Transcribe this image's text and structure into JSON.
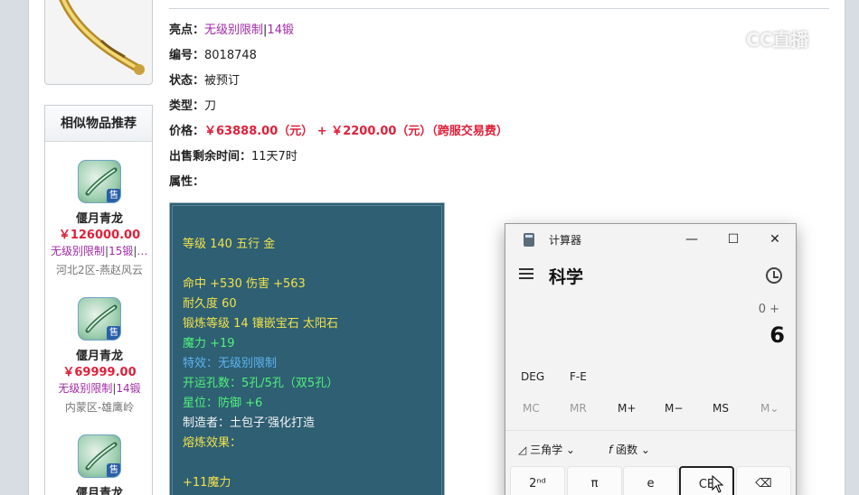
{
  "similar": {
    "title": "相似物品推荐",
    "sold_badge": "售",
    "items": [
      {
        "name": "偃月青龙",
        "price": "￥126000.00",
        "tag1": "无级别限制",
        "tag2": "15锻",
        "tag3": "力…",
        "server": "河北2区-燕赵风云"
      },
      {
        "name": "偃月青龙",
        "price": "￥69999.00",
        "tag1": "无级别限制",
        "tag2": "14锻",
        "tag3": "",
        "server": "内蒙区-雄鹰岭"
      },
      {
        "name": "偃月青龙",
        "price": "",
        "tag1": "",
        "tag2": "",
        "tag3": "",
        "server": ""
      }
    ]
  },
  "detail": {
    "highlight_label": "亮点：",
    "highlight_1": "无级别限制",
    "highlight_2": "14锻",
    "id_label": "编号：",
    "id_value": "8018748",
    "status_label": "状态：",
    "status_value": "被预订",
    "type_label": "类型：",
    "type_value": "刀",
    "price_label": "价格：",
    "price_value": "￥63888.00（元） + ￥2200.00（元）（跨服交易费）",
    "time_label": "出售剩余时间：",
    "time_value": "11天7时",
    "attr_label": "属性："
  },
  "attributes": {
    "level": "等级 140 五行 金",
    "hit": "命中 +530 伤害 +563",
    "durability": "耐久度 60",
    "forging": "锻炼等级 14 镶嵌宝石 太阳石",
    "magic": "魔力 +19",
    "special": "特效：无级别限制",
    "holes": "开运孔数：5孔/5孔（双5孔）",
    "star": "星位：防御 +6",
    "maker": "制造者：土包子′强化打造",
    "melt": "熔炼效果：",
    "melt_value": "+11魔力"
  },
  "watermark": "CC直播",
  "calculator": {
    "app_title": "计算器",
    "mode": "科学",
    "expression": "0 +",
    "display": "6",
    "angle_unit": "DEG",
    "fe": "F-E",
    "memory": [
      "MC",
      "MR",
      "M+",
      "M−",
      "MS",
      "M⌄"
    ],
    "trig": "三角学",
    "func": "函数",
    "keys": [
      "2ⁿᵈ",
      "π",
      "e",
      "CE",
      "⌫"
    ]
  },
  "colors": {
    "price_red": "#e0203a",
    "tag_purple": "#a02aa6",
    "attr_bg": "#2e5f73"
  }
}
